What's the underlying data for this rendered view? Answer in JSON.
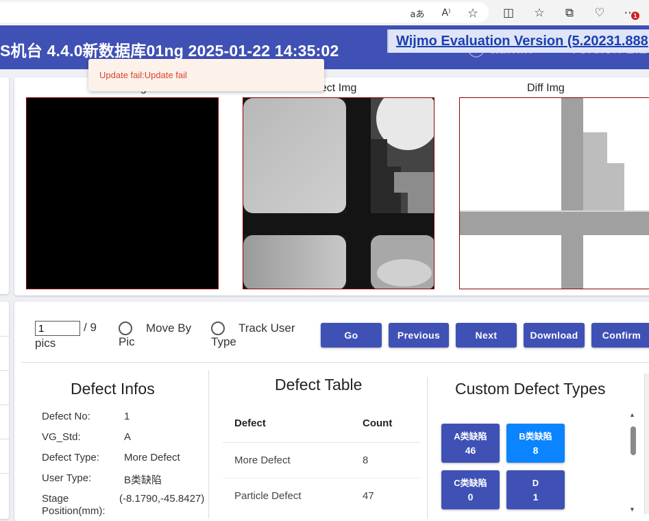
{
  "browser": {
    "icons": [
      "read-aloud-icon",
      "text-size-icon",
      "favorite-star-icon",
      "split-screen-icon",
      "favorites-icon",
      "collections-icon",
      "browser-essentials-icon",
      "more-icon"
    ],
    "icon_glyphs": [
      "aあ",
      "A⁾",
      "☆",
      "◫",
      "☆",
      "⧉",
      "♡",
      "⋯"
    ],
    "badge_count": "1"
  },
  "header": {
    "title": "S机台   4.4.0新数据库01ng   2025-01-22 14:35:02",
    "ghost_user": "admin",
    "ghost_version": "Version 1.2",
    "wijmo_notice": "Wijmo Evaluation Version (5.20231.888"
  },
  "toast": {
    "message": "Update fail:Update fail"
  },
  "images": {
    "golden_label": "Golden Img",
    "defect_label": "Defect Img",
    "diff_label": "Diff Img"
  },
  "controls": {
    "page_value": "1",
    "page_total": "/ 9",
    "pics_label": "pics",
    "move_by_pic_line1": "Move By",
    "move_by_pic_line2": "Pic",
    "track_user_type_line1": "Track User",
    "track_user_type_line2": "Type",
    "buttons": {
      "go": "Go",
      "previous": "Previous",
      "next": "Next",
      "download": "Download",
      "confirm": "Confirm"
    }
  },
  "defect_infos": {
    "title": "Defect Infos",
    "rows": [
      {
        "key": "Defect No:",
        "value": "1"
      },
      {
        "key": "VG_Std:",
        "value": "A"
      },
      {
        "key": "Defect Type:",
        "value": "More Defect"
      },
      {
        "key": "User Type:",
        "value": "B类缺陷"
      },
      {
        "key": "Stage",
        "value": "(-8.1790,-45.8427)"
      },
      {
        "key": "Position(mm):",
        "value": ""
      }
    ]
  },
  "defect_table": {
    "title": "Defect Table",
    "headers": {
      "defect": "Defect",
      "count": "Count"
    },
    "rows": [
      {
        "defect": "More Defect",
        "count": "8"
      },
      {
        "defect": "Particle Defect",
        "count": "47"
      }
    ]
  },
  "custom_types": {
    "title": "Custom Defect Types",
    "items": [
      {
        "name": "A类缺陷",
        "count": "46",
        "active": false
      },
      {
        "name": "B类缺陷",
        "count": "8",
        "active": true
      },
      {
        "name": "C类缺陷",
        "count": "0",
        "active": false
      },
      {
        "name": "D",
        "count": "1",
        "active": false
      }
    ]
  },
  "colors": {
    "primary": "#3f51b5",
    "active": "#0a84ff",
    "toast_text": "#d8422f",
    "image_border": "#8b0000"
  }
}
